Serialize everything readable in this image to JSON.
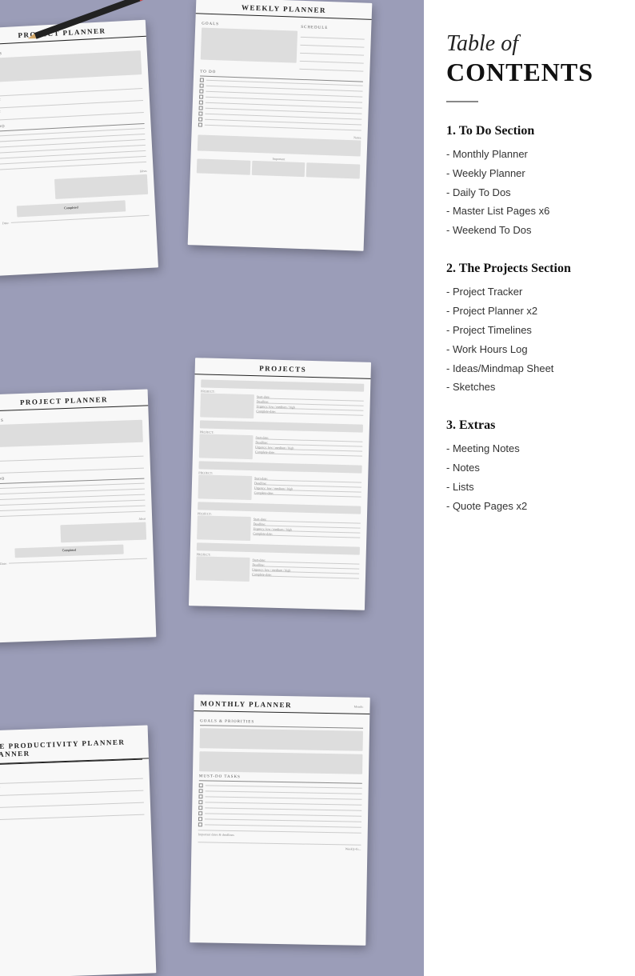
{
  "left_panel": {
    "pencil_label": "pencil"
  },
  "right_panel": {
    "title_italic": "Table of",
    "title_bold": "CONTENTS",
    "divider": true,
    "sections": [
      {
        "number": "1.",
        "heading": "To Do Section",
        "items": [
          "- Monthly Planner",
          "- Weekly Planner",
          "- Daily To Dos",
          "- Master List Pages x6",
          "- Weekend To Dos"
        ]
      },
      {
        "number": "2.",
        "heading": "The Projects Section",
        "items": [
          "- Project Tracker",
          "- Project Planner x2",
          "- Project Timelines",
          "- Work Hours Log",
          "- Ideas/Mindmap Sheet",
          "- Sketches"
        ]
      },
      {
        "number": "3.",
        "heading": "Extras",
        "items": [
          "- Meeting Notes",
          "- Notes",
          "- Lists",
          "- Quote Pages x2"
        ]
      }
    ]
  },
  "pages": {
    "project_planner_title": "PROJECT PLANNER",
    "weekly_planner_title": "WEEKLY PLANNER",
    "projects_title": "PROJECTS",
    "monthly_planner_title": "MONTHLY PLANNER",
    "productivity_title": "the PRODUCTIVITY PLANNER",
    "notes_label": "NOTES",
    "to_do_label": "TO DO",
    "goals_label": "GOALS",
    "schedule_label": "SCHEDULE",
    "ideas_label": "Ideas",
    "completed_label": "Completed",
    "goals_priorities_label": "GOALS & PRIORITIES",
    "must_do_tasks_label": "MUST-DO TASKS"
  }
}
